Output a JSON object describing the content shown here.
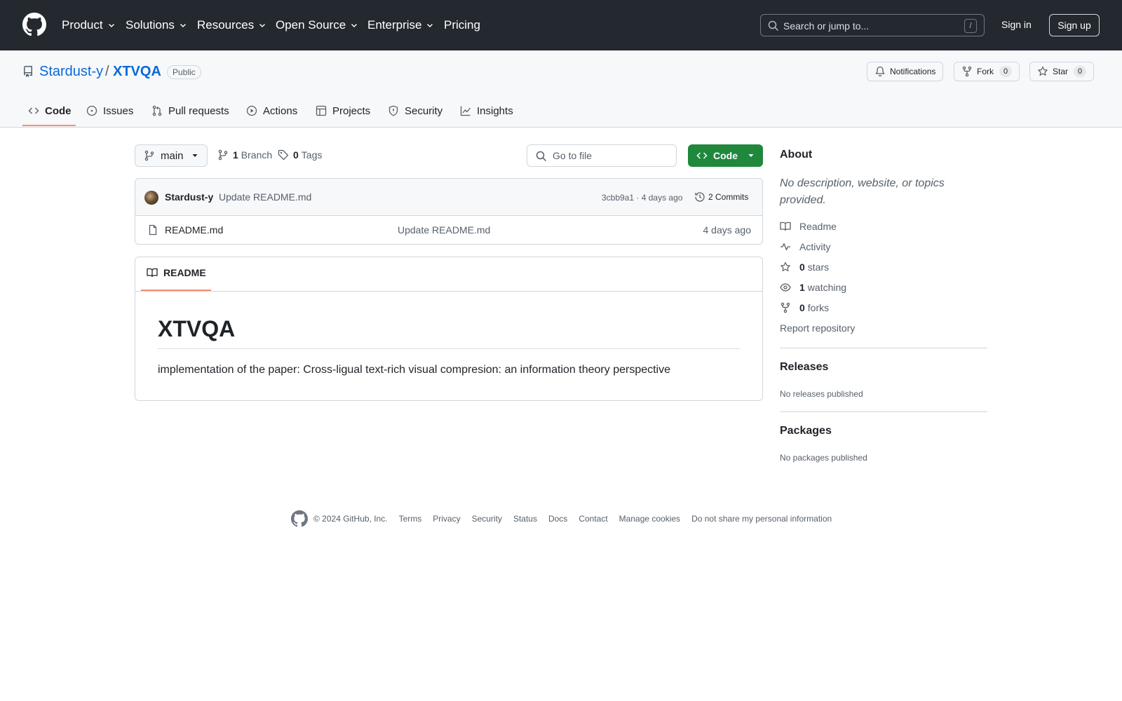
{
  "header": {
    "nav": [
      {
        "label": "Product"
      },
      {
        "label": "Solutions"
      },
      {
        "label": "Resources"
      },
      {
        "label": "Open Source"
      },
      {
        "label": "Enterprise"
      },
      {
        "label": "Pricing"
      }
    ],
    "search_placeholder": "Search or jump to...",
    "search_shortcut": "/",
    "sign_in": "Sign in",
    "sign_up": "Sign up"
  },
  "repo": {
    "owner": "Stardust-y",
    "separator": "/",
    "name": "XTVQA",
    "visibility": "Public",
    "notifications_label": "Notifications",
    "fork_label": "Fork",
    "fork_count": "0",
    "star_label": "Star",
    "star_count": "0"
  },
  "tabs": [
    {
      "label": "Code",
      "icon": "code-icon",
      "active": true
    },
    {
      "label": "Issues",
      "icon": "issue-icon"
    },
    {
      "label": "Pull requests",
      "icon": "pull-request-icon"
    },
    {
      "label": "Actions",
      "icon": "play-icon"
    },
    {
      "label": "Projects",
      "icon": "table-icon"
    },
    {
      "label": "Security",
      "icon": "shield-icon"
    },
    {
      "label": "Insights",
      "icon": "graph-icon"
    }
  ],
  "toolbar": {
    "branch": "main",
    "branch_count": "1",
    "branch_label": "Branch",
    "tag_count": "0",
    "tag_label": "Tags",
    "goto_file": "Go to file",
    "code_button": "Code"
  },
  "commit": {
    "author": "Stardust-y",
    "message": "Update README.md",
    "hash_time": "3cbb9a1 · 4 days ago",
    "commits": "2 Commits"
  },
  "files": [
    {
      "name": "README.md",
      "message": "Update README.md",
      "date": "4 days ago"
    }
  ],
  "readme": {
    "tab_label": "README",
    "title": "XTVQA",
    "body": "implementation of the paper: Cross-ligual text-rich visual compresion: an information theory perspective"
  },
  "about": {
    "heading": "About",
    "description": "No description, website, or topics provided.",
    "readme_link": "Readme",
    "activity_link": "Activity",
    "stars_count": "0",
    "stars_label": "stars",
    "watching_count": "1",
    "watching_label": "watching",
    "forks_count": "0",
    "forks_label": "forks",
    "report": "Report repository"
  },
  "releases": {
    "heading": "Releases",
    "empty": "No releases published"
  },
  "packages": {
    "heading": "Packages",
    "empty": "No packages published"
  },
  "footer": {
    "copyright": "© 2024 GitHub, Inc.",
    "links": [
      "Terms",
      "Privacy",
      "Security",
      "Status",
      "Docs",
      "Contact",
      "Manage cookies",
      "Do not share my personal information"
    ]
  },
  "colors": {
    "header_bg": "#24292f",
    "link": "#0969da",
    "primary_button": "#1f883d",
    "active_tab_underline": "#fd8c73"
  }
}
